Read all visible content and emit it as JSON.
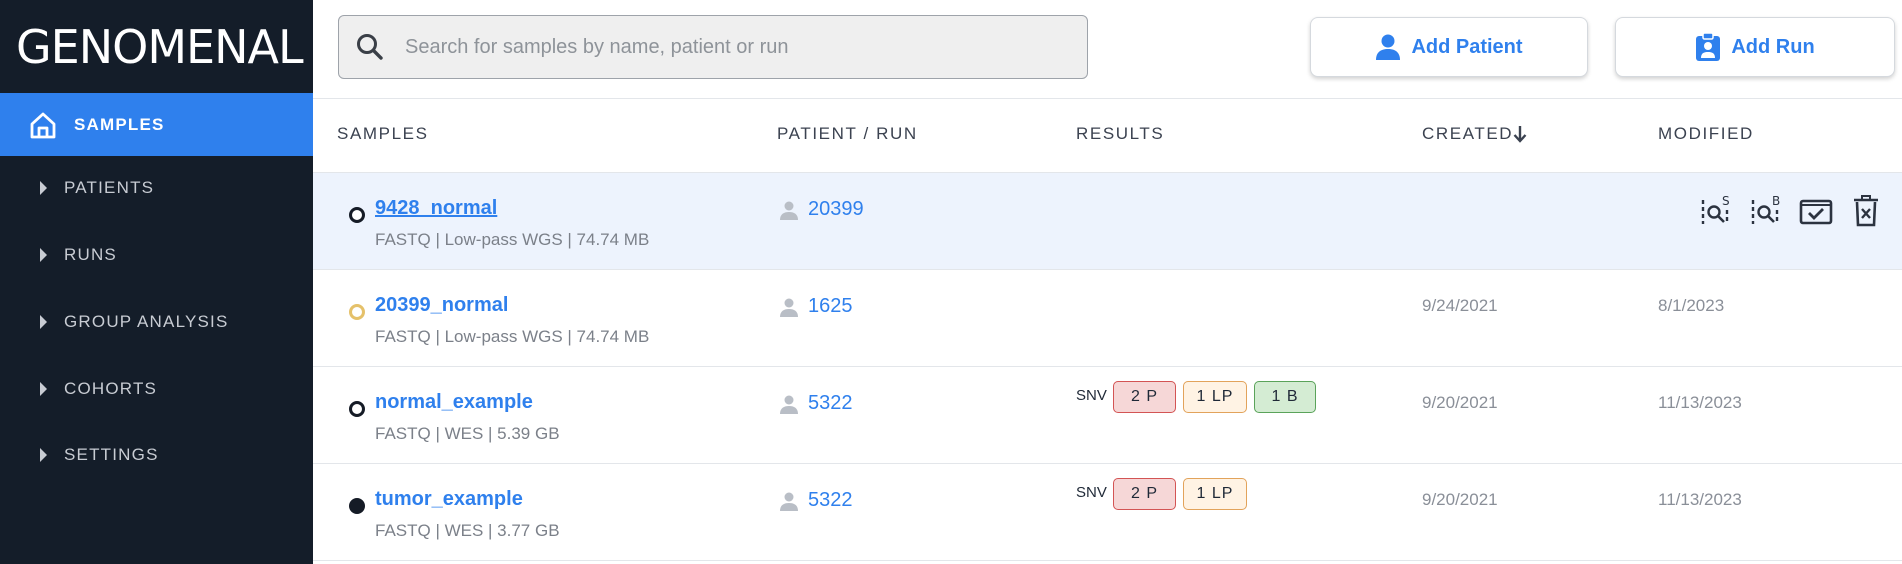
{
  "app": {
    "logo": "GENOMENAL"
  },
  "sidebar": {
    "active": {
      "label": "SAMPLES",
      "icon": "home-icon"
    },
    "items": [
      {
        "label": "PATIENTS",
        "icon": "caret-right-icon"
      },
      {
        "label": "RUNS",
        "icon": "caret-right-icon"
      },
      {
        "label": "GROUP ANALYSIS",
        "icon": "caret-right-icon"
      },
      {
        "label": "COHORTS",
        "icon": "caret-right-icon"
      },
      {
        "label": "SETTINGS",
        "icon": "caret-right-icon"
      }
    ]
  },
  "search": {
    "placeholder": "Search for samples by name, patient or run",
    "value": ""
  },
  "actions": {
    "add_patient": "Add Patient",
    "add_run": "Add Run"
  },
  "table": {
    "headers": {
      "samples": "SAMPLES",
      "patient_run": "PATIENT / RUN",
      "results": "RESULTS",
      "created": "CREATED",
      "modified": "MODIFIED"
    },
    "sort": {
      "column": "created",
      "direction": "descending",
      "icon": "arrow-down-icon"
    },
    "rows": [
      {
        "status": "outline",
        "name": "9428_normal",
        "meta": "FASTQ | Low-pass WGS | 74.74 MB",
        "patient": "20399",
        "snv_label": "",
        "results": [],
        "created": "",
        "modified": "",
        "selected": true,
        "row_actions": [
          "igv-s-icon",
          "igv-b-icon",
          "validate-icon",
          "delete-icon"
        ]
      },
      {
        "status": "pending",
        "name": "20399_normal",
        "meta": "FASTQ | Low-pass WGS | 74.74 MB",
        "patient": "1625",
        "snv_label": "",
        "results": [],
        "created": "9/24/2021",
        "modified": "8/1/2023",
        "selected": false
      },
      {
        "status": "outline",
        "name": "normal_example",
        "meta": "FASTQ | WES | 5.39 GB",
        "patient": "5322",
        "snv_label": "SNV",
        "results": [
          {
            "text": "2 P",
            "kind": "p"
          },
          {
            "text": "1 LP",
            "kind": "lp"
          },
          {
            "text": "1 B",
            "kind": "b"
          }
        ],
        "created": "9/20/2021",
        "modified": "11/13/2023",
        "selected": false
      },
      {
        "status": "filled",
        "name": "tumor_example",
        "meta": "FASTQ | WES | 3.77 GB",
        "patient": "5322",
        "snv_label": "SNV",
        "results": [
          {
            "text": "2 P",
            "kind": "p"
          },
          {
            "text": "1 LP",
            "kind": "lp"
          }
        ],
        "created": "9/20/2021",
        "modified": "11/13/2023",
        "selected": false
      }
    ]
  },
  "colors": {
    "sidebar_bg": "#141d29",
    "accent": "#2f80ed",
    "selected_row": "#edf3fd",
    "pathogenic": "#d35454",
    "likely_pathogenic": "#e2a35b",
    "benign": "#5aa35a"
  }
}
